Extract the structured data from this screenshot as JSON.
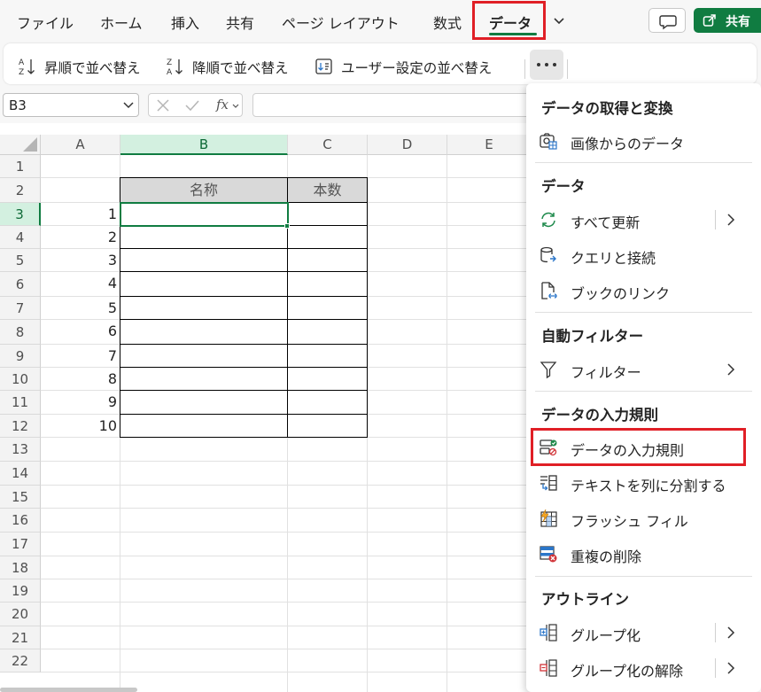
{
  "tabs": [
    {
      "label": "ファイル"
    },
    {
      "label": "ホーム"
    },
    {
      "label": "挿入"
    },
    {
      "label": "共有"
    },
    {
      "label": "ページ レイアウト"
    },
    {
      "label": "数式"
    },
    {
      "label": "データ"
    }
  ],
  "active_tab": "データ",
  "share_label": "共有",
  "ribbon": {
    "sort_asc": "昇順で並べ替え",
    "sort_desc": "降順で並べ替え",
    "custom_sort": "ユーザー設定の並べ替え"
  },
  "formula_bar": {
    "name_box": "B3",
    "fx": "fx",
    "formula": ""
  },
  "grid": {
    "columns": [
      "A",
      "B",
      "C",
      "D",
      "E"
    ],
    "selected_column": "B",
    "rows": [
      "1",
      "2",
      "3",
      "4",
      "5",
      "6",
      "7",
      "8",
      "9",
      "10",
      "11",
      "12",
      "13",
      "14",
      "15",
      "16",
      "17",
      "18",
      "19",
      "20",
      "21",
      "22"
    ],
    "selected_row": "3",
    "active_cell": "B3",
    "table_headers": [
      "名称",
      "本数"
    ],
    "row_numbers": [
      "1",
      "2",
      "3",
      "4",
      "5",
      "6",
      "7",
      "8",
      "9",
      "10"
    ]
  },
  "menu": {
    "sections": [
      {
        "heading": "データの取得と変換",
        "items": [
          {
            "label": "画像からのデータ",
            "icon": "image-data-icon"
          }
        ]
      },
      {
        "heading": "データ",
        "items": [
          {
            "label": "すべて更新",
            "icon": "refresh-icon",
            "submenu": true
          },
          {
            "label": "クエリと接続",
            "icon": "query-connection-icon"
          },
          {
            "label": "ブックのリンク",
            "icon": "workbook-links-icon"
          }
        ]
      },
      {
        "heading": "自動フィルター",
        "items": [
          {
            "label": "フィルター",
            "icon": "filter-icon",
            "submenu": true
          }
        ]
      },
      {
        "heading": "データの入力規則",
        "items": [
          {
            "label": "データの入力規則",
            "icon": "data-validation-icon",
            "highlighted": true
          },
          {
            "label": "テキストを列に分割する",
            "icon": "text-to-columns-icon"
          },
          {
            "label": "フラッシュ フィル",
            "icon": "flash-fill-icon"
          },
          {
            "label": "重複の削除",
            "icon": "remove-duplicates-icon"
          }
        ]
      },
      {
        "heading": "アウトライン",
        "items": [
          {
            "label": "グループ化",
            "icon": "group-icon",
            "submenu": true
          },
          {
            "label": "グループ化の解除",
            "icon": "ungroup-icon",
            "submenu": true
          }
        ]
      }
    ]
  },
  "colors": {
    "accent_green": "#107c41",
    "highlight_red": "#e01f26",
    "table_header_gray": "#d9d9d9"
  }
}
